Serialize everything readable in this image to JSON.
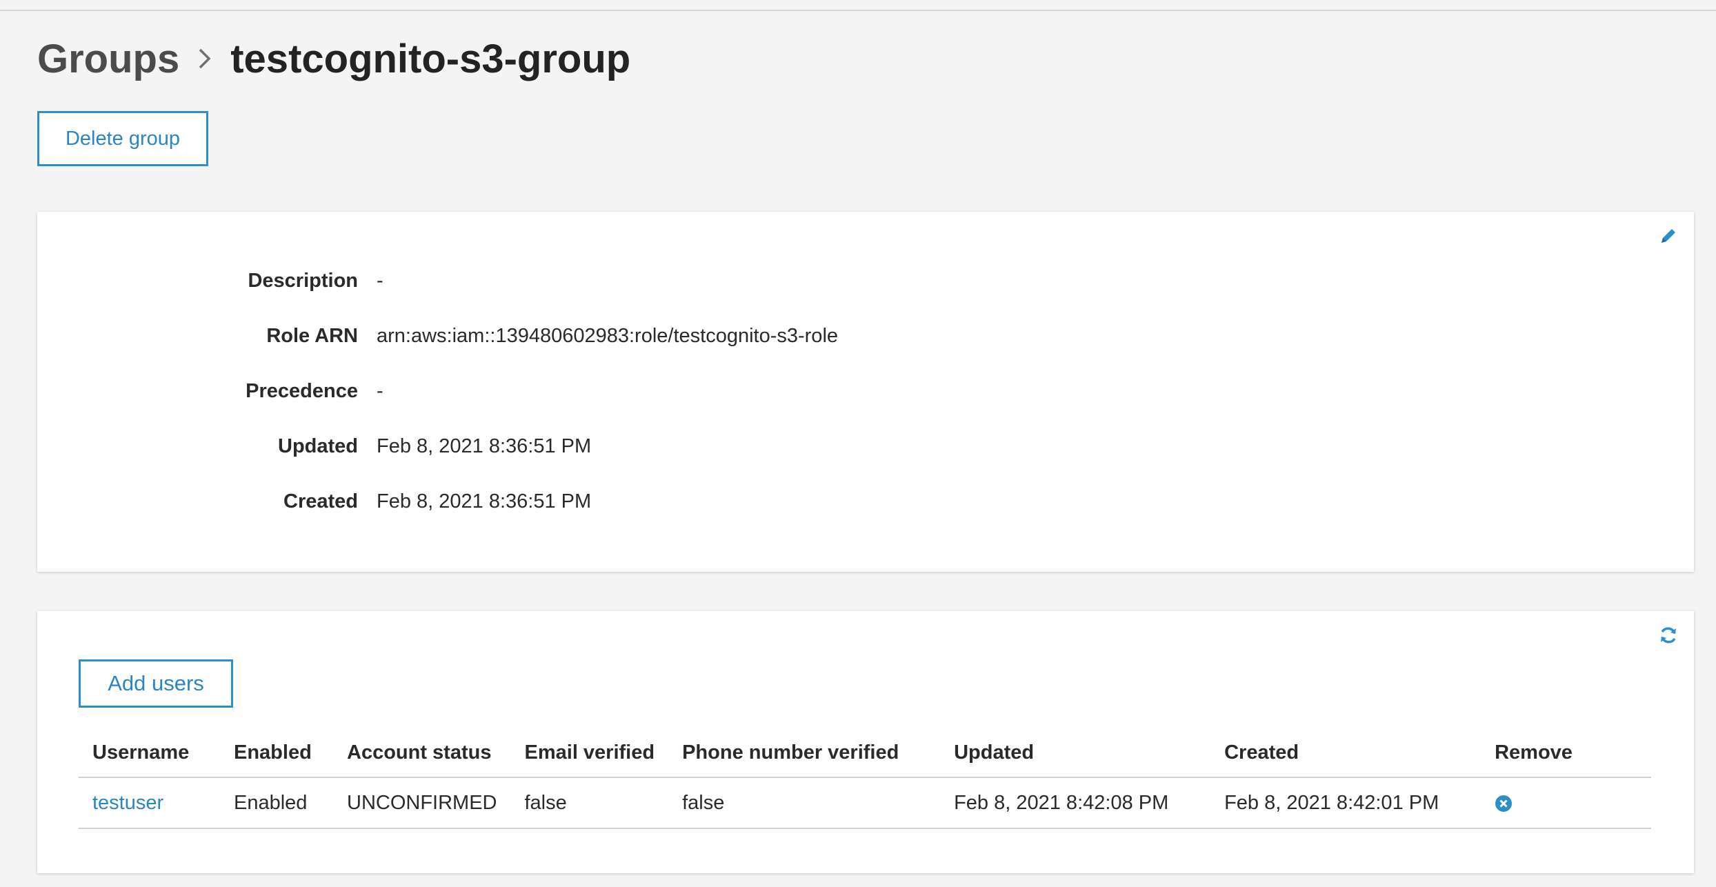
{
  "breadcrumb": {
    "parent": "Groups",
    "current": "testcognito-s3-group"
  },
  "actions": {
    "delete_group": "Delete group",
    "add_users": "Add users"
  },
  "details": {
    "description": {
      "label": "Description",
      "value": "-"
    },
    "role_arn": {
      "label": "Role ARN",
      "value": "arn:aws:iam::139480602983:role/testcognito-s3-role"
    },
    "precedence": {
      "label": "Precedence",
      "value": "-"
    },
    "updated": {
      "label": "Updated",
      "value": "Feb 8, 2021 8:36:51 PM"
    },
    "created": {
      "label": "Created",
      "value": "Feb 8, 2021 8:36:51 PM"
    }
  },
  "icons": {
    "edit": "pencil-icon",
    "refresh": "refresh-icon",
    "remove": "remove-circle-x-icon",
    "breadcrumb_separator": "chevron-right-icon"
  },
  "colors": {
    "accent": "#2c8fc9",
    "background": "#f3f4f3"
  },
  "users_table": {
    "columns": [
      "Username",
      "Enabled",
      "Account status",
      "Email verified",
      "Phone number verified",
      "Updated",
      "Created",
      "Remove"
    ],
    "rows": [
      {
        "username": "testuser",
        "enabled": "Enabled",
        "account_status": "UNCONFIRMED",
        "email_verified": "false",
        "phone_verified": "false",
        "updated": "Feb 8, 2021 8:42:08 PM",
        "created": "Feb 8, 2021 8:42:01 PM"
      }
    ]
  }
}
